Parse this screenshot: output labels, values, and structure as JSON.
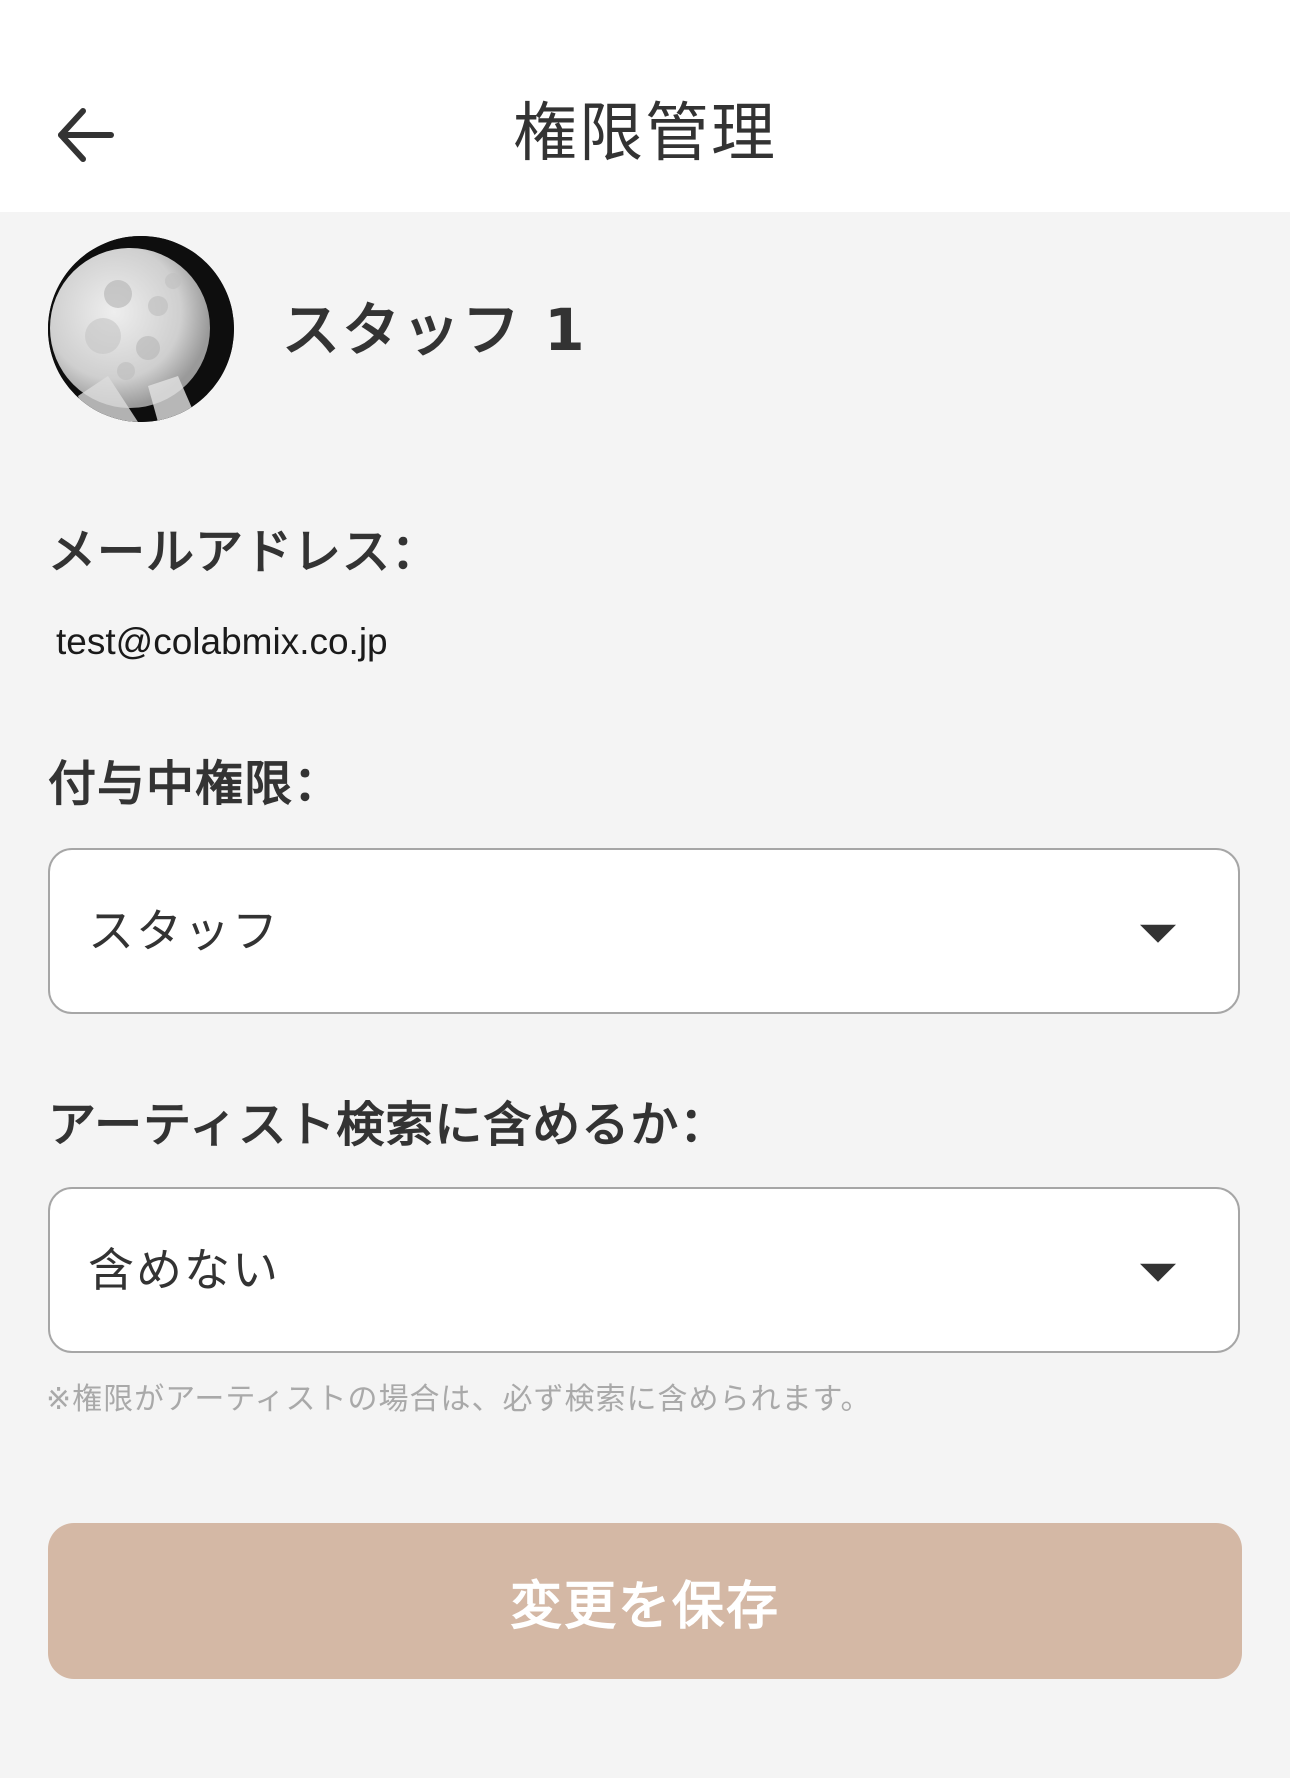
{
  "header": {
    "title": "権限管理",
    "back_icon": "arrow-left-icon"
  },
  "user": {
    "name": "スタッフ 1",
    "avatar": "moon-avatar"
  },
  "email": {
    "label": "メールアドレス：",
    "value": "test@colabmix.co.jp"
  },
  "permission": {
    "label": "付与中権限：",
    "selected": "スタッフ"
  },
  "artist_search": {
    "label": "アーティスト検索に含めるか：",
    "selected": "含めない",
    "note": "※権限がアーティストの場合は、必ず検索に含められます。"
  },
  "save_button": {
    "label": "変更を保存",
    "color": "#d4b8a5"
  },
  "colors": {
    "background": "#f4f4f4",
    "header": "#ffffff",
    "text": "#333333",
    "note": "#a9a9a9"
  }
}
